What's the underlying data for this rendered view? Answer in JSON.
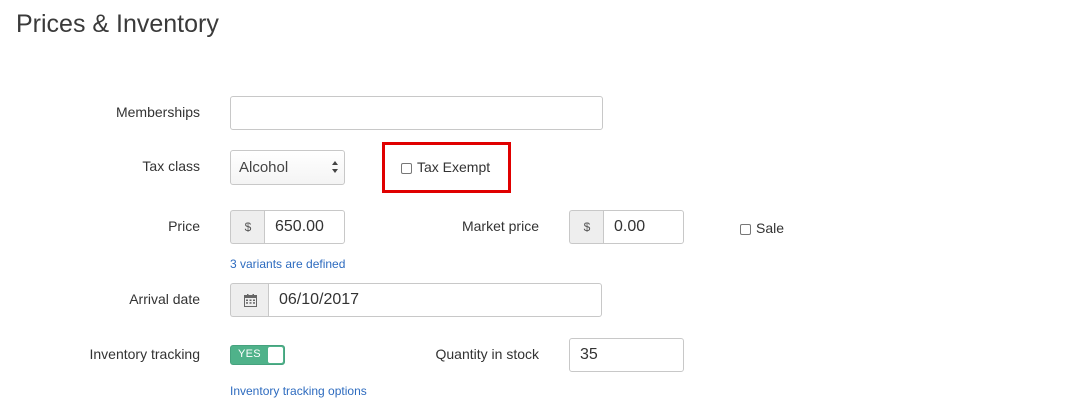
{
  "page": {
    "title": "Prices & Inventory"
  },
  "memberships": {
    "label": "Memberships",
    "value": ""
  },
  "tax_class": {
    "label": "Tax class",
    "selected": "Alcohol",
    "exempt_label": "Tax Exempt",
    "exempt_checked": false
  },
  "price": {
    "label": "Price",
    "currency": "$",
    "value": "650.00",
    "variants_link": "3 variants are defined"
  },
  "market_price": {
    "label": "Market price",
    "currency": "$",
    "value": "0.00"
  },
  "sale": {
    "label": "Sale",
    "checked": false
  },
  "arrival_date": {
    "label": "Arrival date",
    "value": "06/10/2017",
    "icon": "calendar-icon"
  },
  "inventory_tracking": {
    "label": "Inventory tracking",
    "toggle_text": "YES",
    "enabled": true,
    "options_link": "Inventory tracking options"
  },
  "quantity": {
    "label": "Quantity in stock",
    "value": "35"
  },
  "colors": {
    "highlight": "#e00000",
    "toggle_on": "#4fb28a",
    "link": "#2d6bbf"
  }
}
